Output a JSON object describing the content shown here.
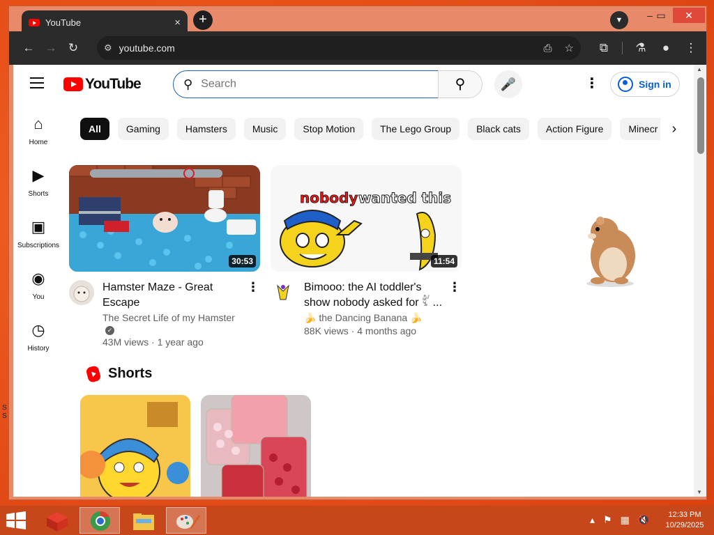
{
  "browser": {
    "tab_title": "YouTube",
    "tab_close": "×",
    "new_tab": "+",
    "url": "youtube.com"
  },
  "youtube": {
    "logo_text": "YouTube",
    "search_placeholder": "Search",
    "sign_in": "Sign in",
    "guide": [
      {
        "label": "Home",
        "icon": "home-icon"
      },
      {
        "label": "Shorts",
        "icon": "shorts-icon"
      },
      {
        "label": "Subscriptions",
        "icon": "subscriptions-icon"
      },
      {
        "label": "You",
        "icon": "you-icon"
      },
      {
        "label": "History",
        "icon": "history-icon"
      }
    ],
    "chips": [
      "All",
      "Gaming",
      "Hamsters",
      "Music",
      "Stop Motion",
      "The Lego Group",
      "Black cats",
      "Action Figure",
      "Minecr"
    ],
    "videos": [
      {
        "title": "Hamster Maze - Great Escape",
        "channel": "The Secret Life of my Hamster",
        "stats": "43M views · 1 year ago",
        "duration": "30:53",
        "verified": true
      },
      {
        "title": "Bimooo: the AI toddler's show nobody asked for 𓀤 ...",
        "channel": "🍌 the Dancing Banana 🍌",
        "stats": "88K views · 4 months ago",
        "duration": "11:54",
        "thumb_text_1": "nobody",
        "thumb_text_2": "wanted this"
      }
    ],
    "shorts_title": "Shorts"
  },
  "taskbar": {
    "time": "12:33 PM",
    "date": "10/29/2025"
  },
  "desktop": {
    "frag1": "S",
    "frag2": "S"
  },
  "colors": {
    "yt_red": "#ff0000",
    "accent_blue": "#065fd4",
    "desktop_orange": "#e8521a"
  }
}
